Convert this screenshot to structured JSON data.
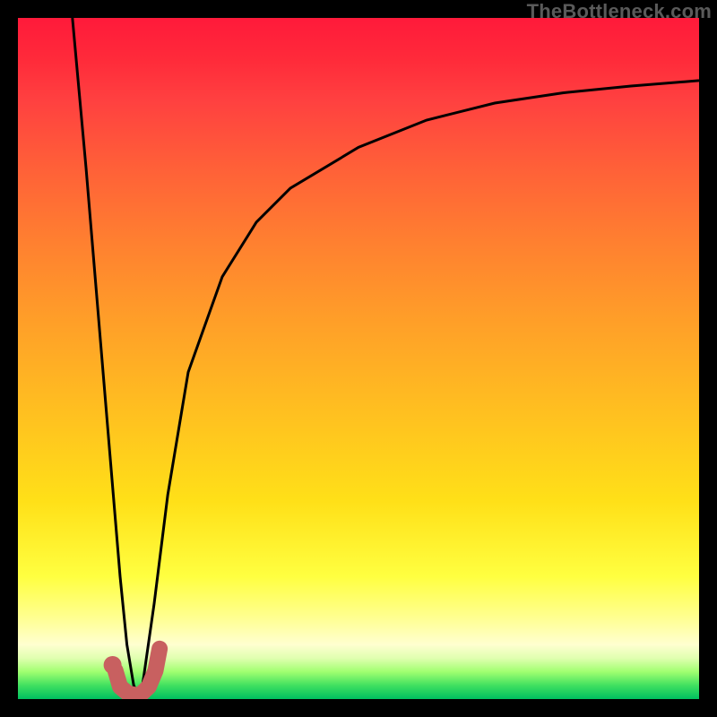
{
  "watermark": "TheBottleneck.com",
  "colors": {
    "frame": "#000000",
    "curve_stroke": "#000000",
    "marker_stroke": "#c86060",
    "marker_fill": "#c86060",
    "gradient_top": "#ff1a3a",
    "gradient_bottom": "#00c060"
  },
  "chart_data": {
    "type": "line",
    "title": "",
    "xlabel": "",
    "ylabel": "",
    "xlim": [
      0,
      100
    ],
    "ylim": [
      0,
      100
    ],
    "grid": false,
    "description": "Bottleneck percentage vs. component index. Two curves descend steeply to a minimum near x≈17 (bottleneck≈0) and one rises asymptotically toward ~90%. A short salmon hook marks the optimum region.",
    "series": [
      {
        "name": "left-branch",
        "x": [
          8,
          10,
          12,
          14,
          15,
          16,
          17,
          18
        ],
        "y": [
          100,
          78,
          54,
          30,
          18,
          8,
          2,
          0
        ]
      },
      {
        "name": "right-branch",
        "x": [
          18,
          20,
          22,
          25,
          30,
          35,
          40,
          50,
          60,
          70,
          80,
          90,
          100
        ],
        "y": [
          0,
          14,
          30,
          48,
          62,
          70,
          75,
          81,
          85,
          87.5,
          89,
          90,
          90.8
        ]
      }
    ],
    "marker": {
      "name": "optimum-hook",
      "points_xy": [
        [
          14.3,
          4.2
        ],
        [
          15.0,
          1.8
        ],
        [
          16.2,
          0.8
        ],
        [
          17.8,
          0.5
        ],
        [
          19.2,
          1.8
        ],
        [
          20.2,
          4.2
        ],
        [
          20.8,
          7.4
        ]
      ],
      "dot_xy": [
        13.9,
        5.0
      ]
    }
  }
}
